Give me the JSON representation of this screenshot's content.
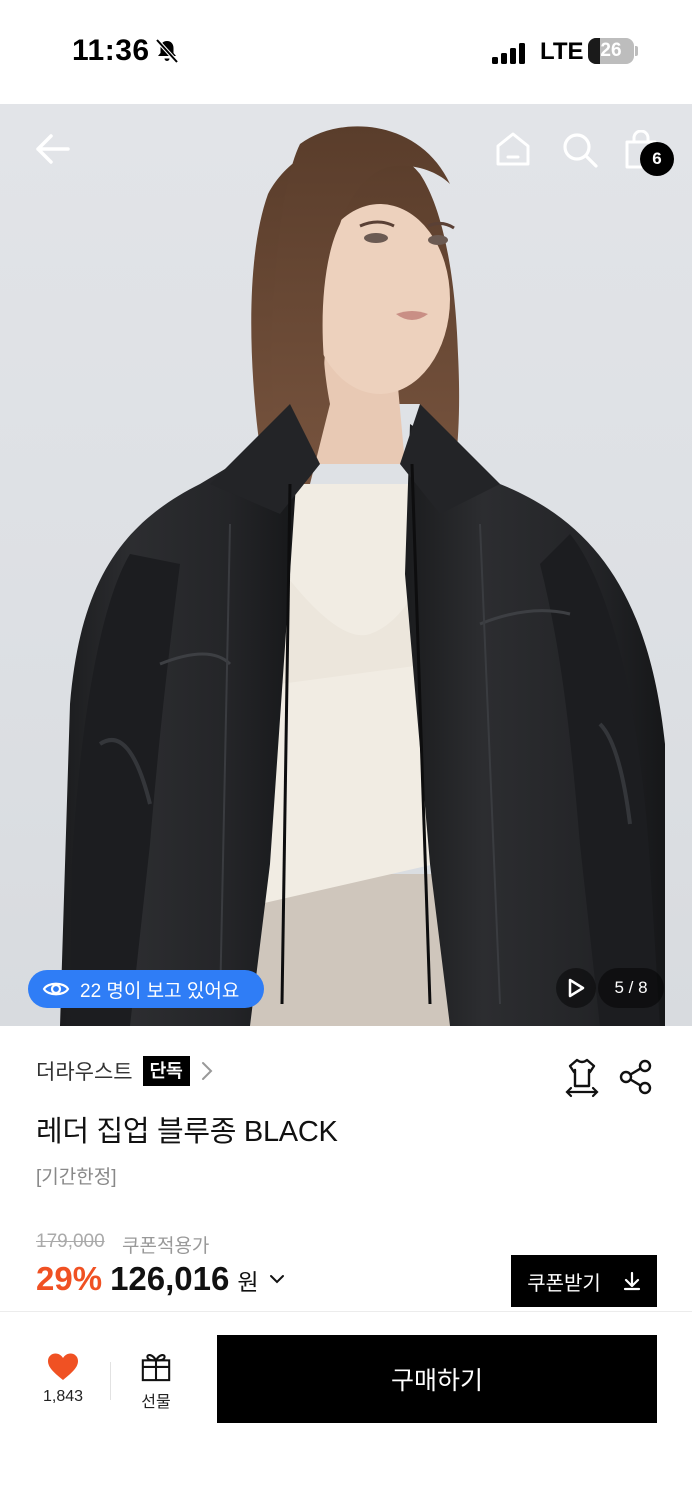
{
  "status_bar": {
    "time": "11:36",
    "network": "LTE",
    "battery": "26",
    "battery_level_percent": 26,
    "icons": [
      "bell-off-icon",
      "signal-icon",
      "battery-icon"
    ]
  },
  "hero": {
    "icons": [
      "back-arrow-icon",
      "home-icon",
      "search-icon",
      "shopping-bag-icon",
      "eye-icon",
      "play-icon"
    ],
    "cart_count": "6",
    "viewers_text": "22 명이 보고 있어요",
    "page_indicator": "5 / 8"
  },
  "product": {
    "brand": "더라우스트",
    "exclusive_badge": "단독",
    "title": "레더 집업 블루종 BLACK",
    "tag": "[기간한정]",
    "icons": [
      "size-guide-icon",
      "share-icon",
      "chevron-right-icon"
    ]
  },
  "price": {
    "original": "179,000",
    "coupon_applied_label": "쿠폰적용가",
    "discount": "29%",
    "sale_price": "126,016",
    "currency": "원",
    "coupon_button": "쿠폰받기",
    "colors": {
      "discount": "#f05123",
      "accent_blue": "#2f7df6"
    }
  },
  "bottom_bar": {
    "like_count": "1,843",
    "gift_label": "선물",
    "buy_button": "구매하기",
    "icons": [
      "heart-icon",
      "gift-icon"
    ],
    "colors": {
      "heart": "#f05123"
    }
  }
}
